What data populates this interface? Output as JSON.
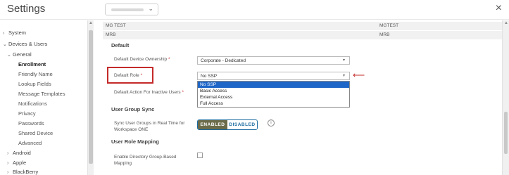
{
  "header": {
    "title": "Settings",
    "close_glyph": "×"
  },
  "sidebar": {
    "items": [
      {
        "label": "System"
      },
      {
        "label": "Devices & Users"
      },
      {
        "label": "General"
      },
      {
        "label": "Enrollment"
      },
      {
        "label": "Friendly Name"
      },
      {
        "label": "Lookup Fields"
      },
      {
        "label": "Message Templates"
      },
      {
        "label": "Notifications"
      },
      {
        "label": "Privacy"
      },
      {
        "label": "Passwords"
      },
      {
        "label": "Shared Device"
      },
      {
        "label": "Advanced"
      },
      {
        "label": "Android"
      },
      {
        "label": "Apple"
      },
      {
        "label": "BlackBerry"
      }
    ]
  },
  "main": {
    "strip1": {
      "left": "MG TEST",
      "right": "MGTEST"
    },
    "strip2": {
      "left": "MRB",
      "right": "MRB"
    },
    "default_section": "Default",
    "ownership": {
      "label": "Default Device Ownership",
      "required": "*",
      "value": "Corporate - Dedicated"
    },
    "role": {
      "label": "Default Role",
      "required": "*",
      "value": "No SSP"
    },
    "role_options": [
      "No SSP",
      "Basic Access",
      "External Access",
      "Full Access"
    ],
    "inactive": {
      "label": "Default Action For Inactive Users",
      "required": "*"
    },
    "user_group_section": "User Group Sync",
    "sync": {
      "label": "Sync User Groups in Real Time for Workspace ONE",
      "enabled": "ENABLED",
      "disabled": "DISABLED",
      "info": "i"
    },
    "role_mapping_section": "User Role Mapping",
    "directory": {
      "label": "Enable Directory Group-Based Mapping"
    }
  },
  "colors": {
    "accent": "#1b6aa0",
    "selected_option": "#1e66c8",
    "highlight": "#c42a2a",
    "enabled_bg": "#6b6b4a"
  }
}
